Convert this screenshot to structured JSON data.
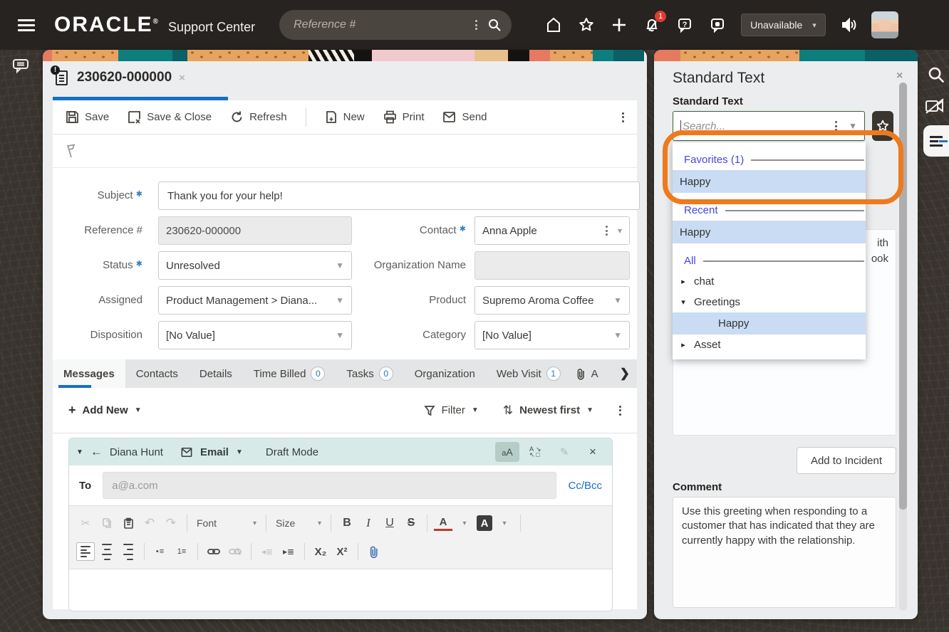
{
  "header": {
    "brand": "ORACLE",
    "brand_reg": "®",
    "product": "Support Center",
    "search_placeholder": "Reference #",
    "bell_badge": "1",
    "status_selector": "Unavailable"
  },
  "incident": {
    "tab_title": "230620-000000",
    "tab_close": "×",
    "toolbar": {
      "save": "Save",
      "save_close": "Save & Close",
      "refresh": "Refresh",
      "new": "New",
      "print": "Print",
      "send": "Send"
    },
    "fields": {
      "subject_label": "Subject",
      "subject_value": "Thank you for your help!",
      "reference_label": "Reference #",
      "reference_value": "230620-000000",
      "status_label": "Status",
      "status_value": "Unresolved",
      "assigned_label": "Assigned",
      "assigned_value": "Product Management > Diana...",
      "disposition_label": "Disposition",
      "disposition_value": "[No Value]",
      "contact_label": "Contact",
      "contact_value": "Anna Apple",
      "org_label": "Organization Name",
      "product_label": "Product",
      "product_value": "Supremo Aroma Coffee",
      "category_label": "Category",
      "category_value": "[No Value]"
    },
    "tabs": [
      {
        "label": "Messages"
      },
      {
        "label": "Contacts"
      },
      {
        "label": "Details"
      },
      {
        "label": "Time Billed",
        "badge": "0"
      },
      {
        "label": "Tasks",
        "badge": "0"
      },
      {
        "label": "Organization"
      },
      {
        "label": "Web Visit",
        "badge": "1"
      },
      {
        "label": "A"
      }
    ],
    "messages_bar": {
      "add_new": "Add New",
      "filter": "Filter",
      "sort": "Newest first"
    },
    "compose": {
      "author": "Diana Hunt",
      "channel": "Email",
      "mode": "Draft Mode",
      "case_toggle": "aA",
      "to_label": "To",
      "to_placeholder": "a@a.com",
      "ccbcc": "Cc/Bcc"
    },
    "rte": {
      "font_label": "Font",
      "size_label": "Size",
      "bold": "B",
      "italic": "I",
      "underline": "U",
      "strike": "S",
      "text_color": "A",
      "bg_color": "A",
      "subscript": "X₂",
      "superscript": "X²"
    }
  },
  "panel": {
    "title": "Standard Text",
    "close": "×",
    "field_label": "Standard Text",
    "search_placeholder": "Search...",
    "dropdown": {
      "favorites_header": "Favorites (1)",
      "favorites_item": "Happy",
      "recent_header": "Recent",
      "recent_item": "Happy",
      "all_header": "All",
      "tree": [
        {
          "arrow": "▸",
          "label": "chat"
        },
        {
          "arrow": "▾",
          "label": "Greetings"
        },
        {
          "label": "Happy"
        },
        {
          "arrow": "▸",
          "label": "Asset"
        }
      ]
    },
    "preview_fragments": [
      "ith",
      "ook"
    ],
    "add_button": "Add to Incident",
    "comment_label": "Comment",
    "comment_text": "Use this greeting when responding to a customer that has indicated that they are currently happy with the relationship."
  },
  "colors": {
    "accent_blue": "#1470c8",
    "highlight_blue": "#c9dcf4",
    "section_header_blue": "#4646df",
    "annotation_orange": "#ee7a1e",
    "badge_red": "#e03c31",
    "compose_teal": "#d8eae7"
  }
}
